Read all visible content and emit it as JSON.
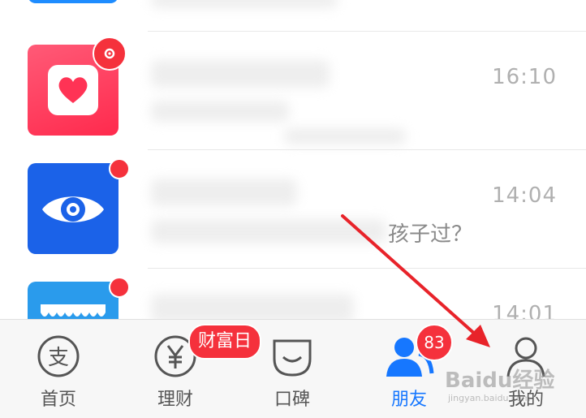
{
  "list": {
    "items": [
      {
        "title": "",
        "subtitle": "",
        "time": ""
      },
      {
        "title": "",
        "subtitle": "",
        "time": "16:10",
        "icon": "heart-icon"
      },
      {
        "title": "",
        "subtitle": "孩子过？",
        "time": "14:04",
        "icon": "eye-icon"
      },
      {
        "title": "",
        "subtitle": "",
        "time": "14:01",
        "icon": "shop-icon"
      }
    ]
  },
  "tabbar": {
    "tabs": [
      {
        "label": "首页",
        "icon": "alipay-icon"
      },
      {
        "label": "理财",
        "icon": "yen-icon"
      },
      {
        "label": "口碑",
        "icon": "koubei-icon"
      },
      {
        "label": "朋友",
        "icon": "friends-icon"
      },
      {
        "label": "我的",
        "icon": "user-icon"
      }
    ],
    "wealth_badge": "财富日",
    "friends_badge": "83"
  },
  "colors": {
    "accent": "#1677ff",
    "badge": "#f5313c"
  },
  "watermark": {
    "main": "Baidu经验",
    "sub": "jingyan.baidu.com"
  }
}
